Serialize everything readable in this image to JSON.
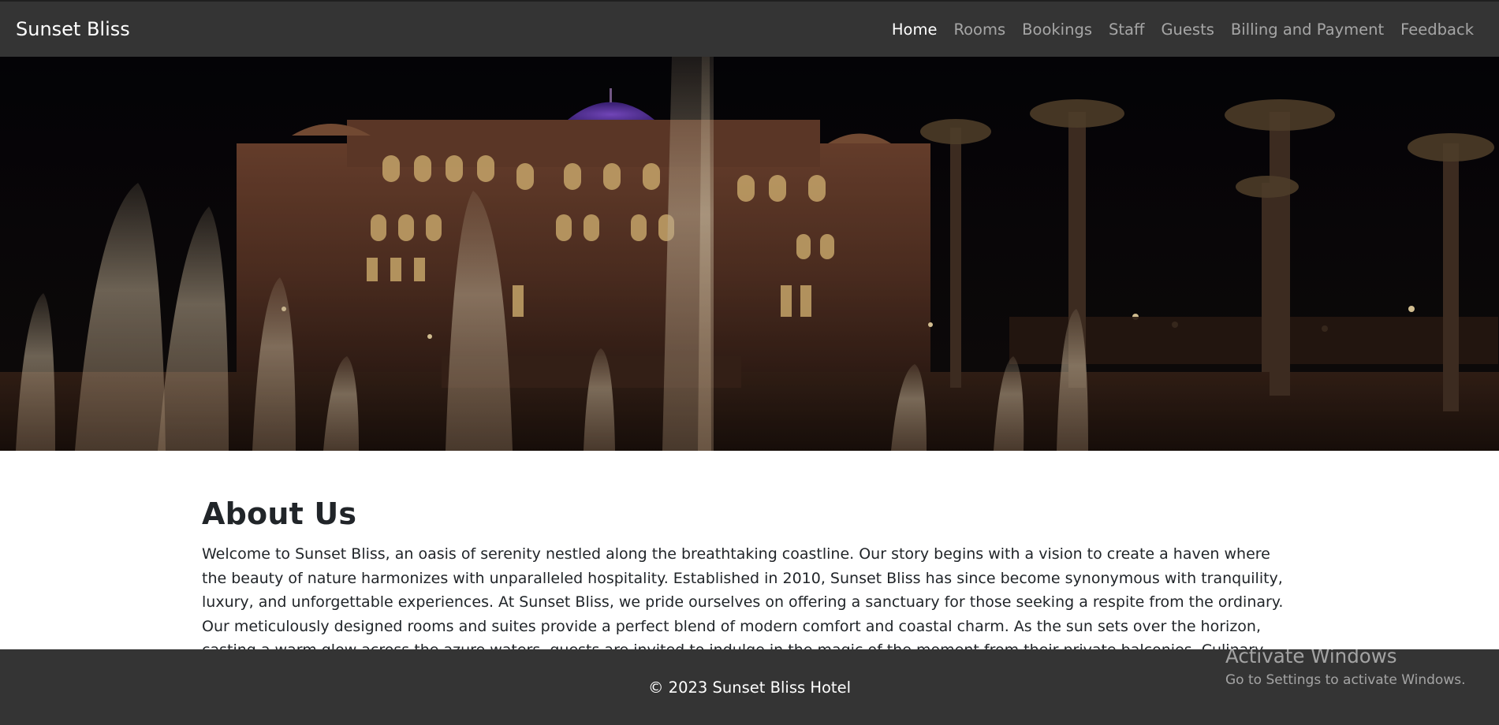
{
  "navbar": {
    "brand": "Sunset Bliss",
    "links": [
      {
        "label": "Home",
        "active": true
      },
      {
        "label": "Rooms",
        "active": false
      },
      {
        "label": "Bookings",
        "active": false
      },
      {
        "label": "Staff",
        "active": false
      },
      {
        "label": "Guests",
        "active": false
      },
      {
        "label": "Billing and Payment",
        "active": false
      },
      {
        "label": "Feedback",
        "active": false
      }
    ]
  },
  "hero": {
    "subject": "hotel-palace-at-night-with-fountains-and-palms"
  },
  "about": {
    "title": "About Us",
    "text": "Welcome to Sunset Bliss, an oasis of serenity nestled along the breathtaking coastline. Our story begins with a vision to create a haven where the beauty of nature harmonizes with unparalleled hospitality. Established in 2010, Sunset Bliss has since become synonymous with tranquility, luxury, and unforgettable experiences. At Sunset Bliss, we pride ourselves on offering a sanctuary for those seeking a respite from the ordinary. Our meticulously designed rooms and suites provide a perfect blend of modern comfort and coastal charm. As the sun sets over the horizon, casting a warm glow across the azure waters, guests are invited to indulge in the magic of the moment from their private balconies. Culinary delights await at our seaside restaurants, where our chefs craft"
  },
  "footer": {
    "text": "© 2023 Sunset Bliss Hotel"
  },
  "watermark": {
    "title": "Activate Windows",
    "subtitle": "Go to Settings to activate Windows."
  },
  "colors": {
    "navbar_bg": "#343434",
    "footer_bg": "#343434",
    "nav_text_muted": "#a0a0a0",
    "nav_text_active": "#ffffff"
  }
}
